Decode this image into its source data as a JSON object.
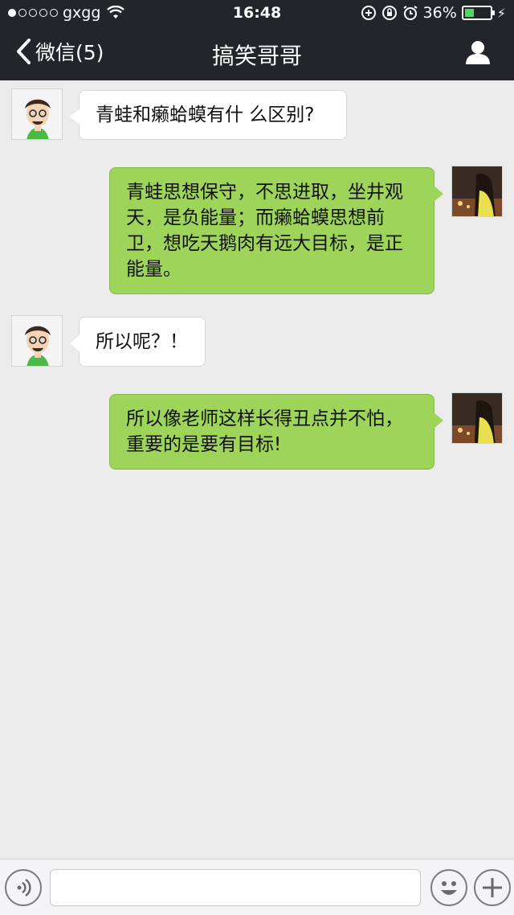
{
  "status_bar": {
    "carrier": "gxgg",
    "time": "16:48",
    "battery": "36%",
    "battery_level": 0.36
  },
  "nav": {
    "back_label": "微信(5)",
    "title": "搞笑哥哥"
  },
  "messages": [
    {
      "from": "them",
      "text": "青蛙和癞蛤蟆有什 么区别?"
    },
    {
      "from": "me",
      "text": "青蛙思想保守，不思进取，坐井观天，是负能量；而癞蛤蟆思想前卫，想吃天鹅肉有远大目标，是正能量。"
    },
    {
      "from": "them",
      "text": "所以呢？！"
    },
    {
      "from": "me",
      "text": "所以像老师这样长得丑点并不怕，重要的是要有目标!"
    }
  ],
  "input": {
    "value": "",
    "placeholder": ""
  },
  "icons": {
    "back": "chevron-left-icon",
    "profile": "person-icon",
    "voice": "voice-icon",
    "emoji": "smiley-icon",
    "more": "plus-icon"
  },
  "colors": {
    "nav_bg": "#222529",
    "bubble_out": "#9ed45a",
    "bubble_in": "#ffffff",
    "chat_bg": "#ebebeb",
    "battery_fill": "#4cd964"
  }
}
